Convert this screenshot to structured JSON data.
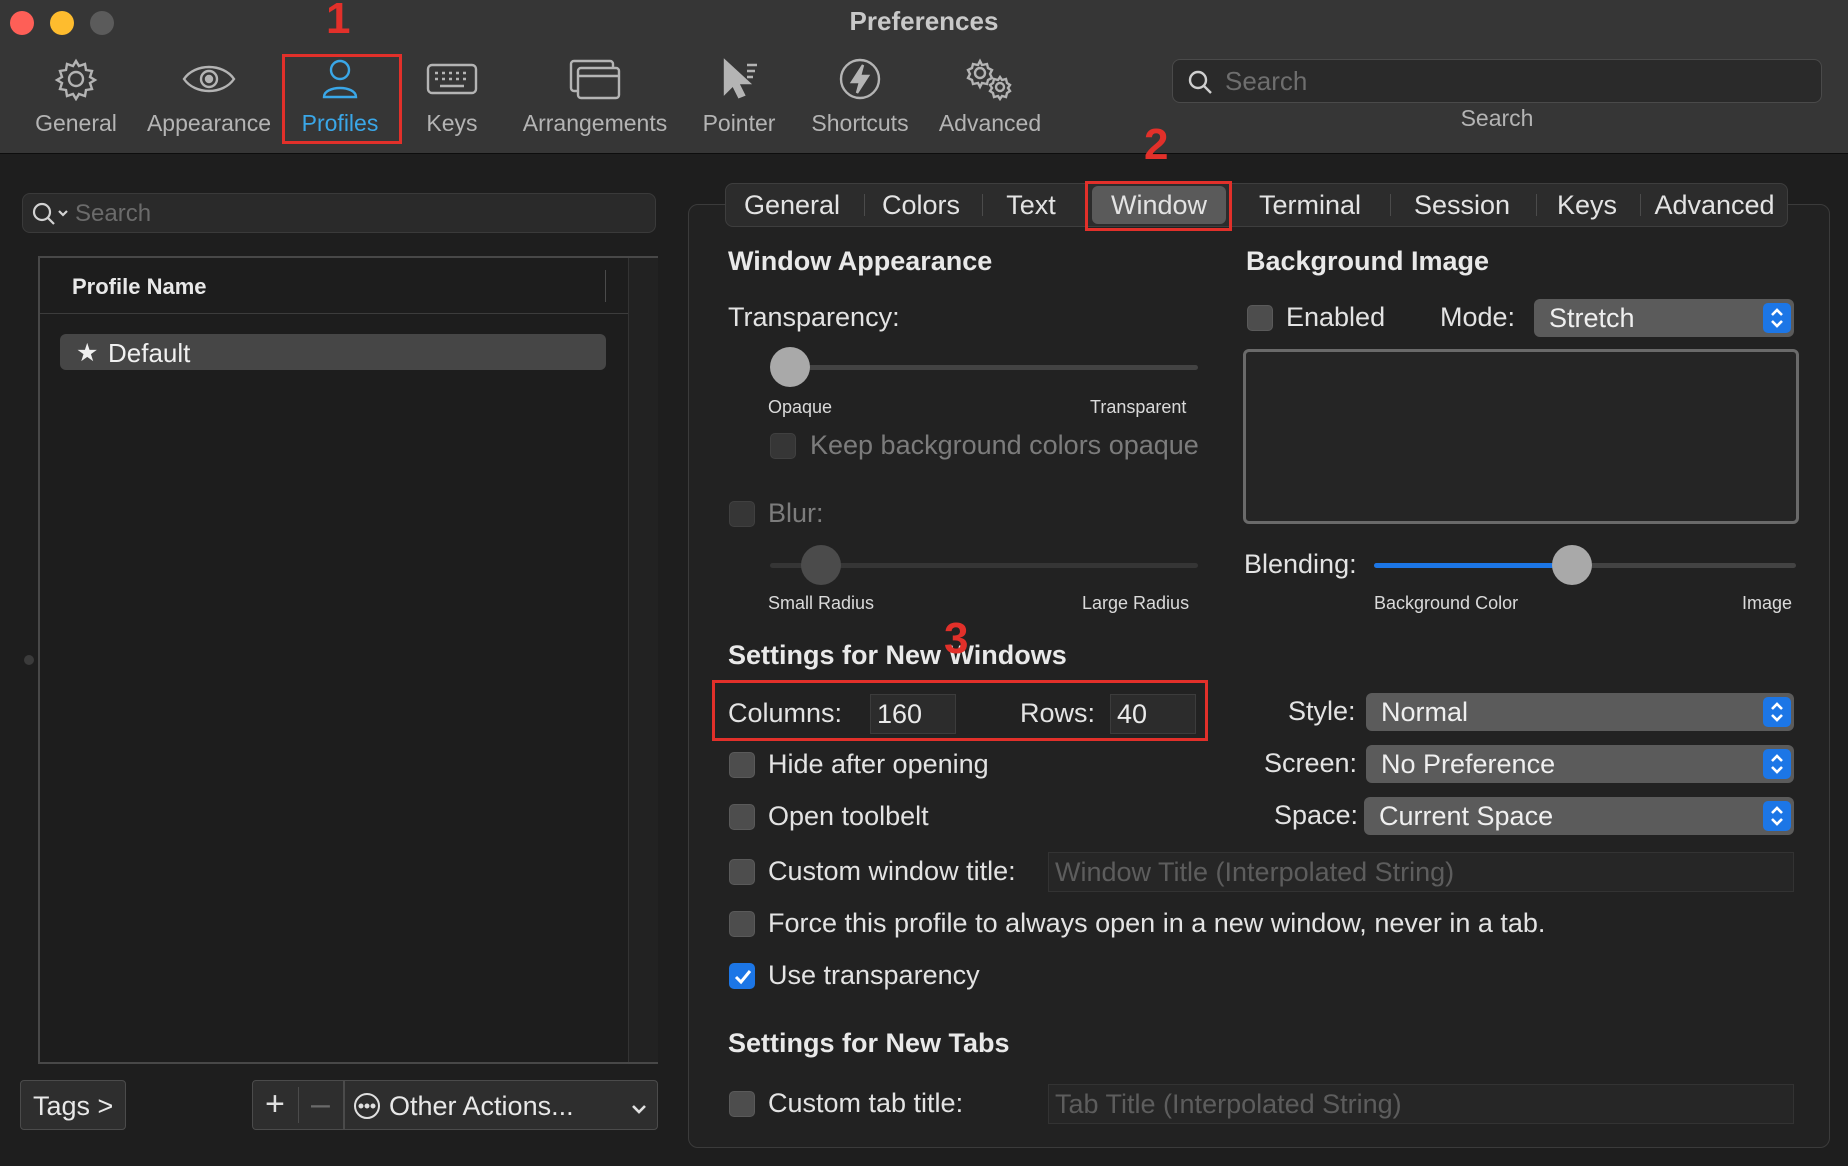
{
  "window": {
    "title": "Preferences"
  },
  "toolbar": {
    "items": [
      {
        "label": "General",
        "icon": "gear-icon"
      },
      {
        "label": "Appearance",
        "icon": "eye-icon"
      },
      {
        "label": "Profiles",
        "icon": "person-icon",
        "active": true
      },
      {
        "label": "Keys",
        "icon": "keyboard-icon"
      },
      {
        "label": "Arrangements",
        "icon": "windows-icon"
      },
      {
        "label": "Pointer",
        "icon": "pointer-icon"
      },
      {
        "label": "Shortcuts",
        "icon": "lightning-icon"
      },
      {
        "label": "Advanced",
        "icon": "gears-icon"
      }
    ],
    "search_placeholder": "Search",
    "search_caption": "Search"
  },
  "annotations": {
    "one": "1",
    "two": "2",
    "three": "3",
    "color": "#e2302a"
  },
  "sidebar": {
    "search_placeholder": "Search",
    "column_header": "Profile Name",
    "profiles": [
      {
        "name": "Default",
        "is_default": true
      }
    ],
    "tags_button": "Tags >",
    "add_symbol": "+",
    "remove_symbol": "–",
    "other_actions": "Other Actions..."
  },
  "profile_tabs": [
    "General",
    "Colors",
    "Text",
    "Window",
    "Terminal",
    "Session",
    "Keys",
    "Advanced"
  ],
  "selected_tab": "Window",
  "window_appearance": {
    "title": "Window Appearance",
    "transparency_label": "Transparency:",
    "transparency_value": 0.0,
    "opaque_label": "Opaque",
    "transparent_label": "Transparent",
    "keep_bg_opaque": "Keep background colors opaque",
    "blur_label": "Blur:",
    "blur_value": 0.08,
    "small_radius": "Small Radius",
    "large_radius": "Large Radius"
  },
  "background_image": {
    "title": "Background Image",
    "enabled_label": "Enabled",
    "enabled": false,
    "mode_label": "Mode:",
    "mode_value": "Stretch",
    "blending_label": "Blending:",
    "blending_value": 0.47,
    "bg_color_label": "Background Color",
    "image_label": "Image"
  },
  "new_windows": {
    "title": "Settings for New Windows",
    "columns_label": "Columns:",
    "columns_value": "160",
    "rows_label": "Rows:",
    "rows_value": "40",
    "style_label": "Style:",
    "style_value": "Normal",
    "screen_label": "Screen:",
    "screen_value": "No Preference",
    "space_label": "Space:",
    "space_value": "Current Space",
    "hide_after_opening": "Hide after opening",
    "open_toolbelt": "Open toolbelt",
    "custom_window_title": "Custom window title:",
    "window_title_placeholder": "Window Title (Interpolated String)",
    "force_new_window": "Force this profile to always open in a new window, never in a tab.",
    "use_transparency": "Use transparency",
    "use_transparency_checked": true
  },
  "new_tabs": {
    "title": "Settings for New Tabs",
    "custom_tab_title": "Custom tab title:",
    "tab_title_placeholder": "Tab Title (Interpolated String)"
  },
  "colors": {
    "accent": "#1c76e6",
    "active_tool": "#3aa7e8"
  }
}
